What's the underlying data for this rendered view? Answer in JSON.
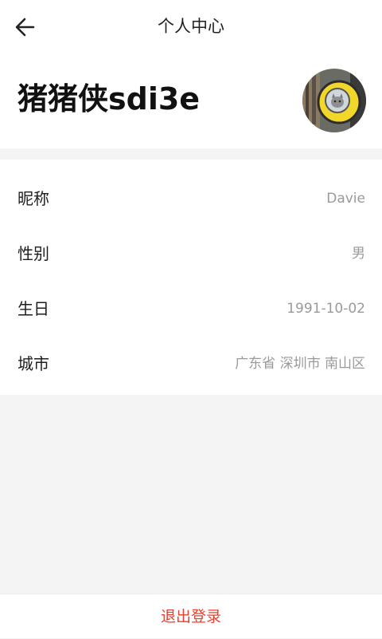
{
  "header": {
    "title": "个人中心",
    "back_icon": "arrow-left-icon"
  },
  "profile": {
    "username": "猪猪侠sdi3e",
    "avatar_icon": "avatar-photo"
  },
  "info": {
    "rows": [
      {
        "label": "昵称",
        "value": "Davie"
      },
      {
        "label": "性别",
        "value": "男"
      },
      {
        "label": "生日",
        "value": "1991-10-02"
      },
      {
        "label": "城市",
        "value": "广东省 深圳市 南山区"
      }
    ]
  },
  "footer": {
    "logout_label": "退出登录"
  },
  "colors": {
    "accent": "#e8412f",
    "background": "#f4f4f5",
    "card": "#ffffff",
    "value_text": "#9a9a9a",
    "avatar_yellow": "#f2d72b"
  }
}
